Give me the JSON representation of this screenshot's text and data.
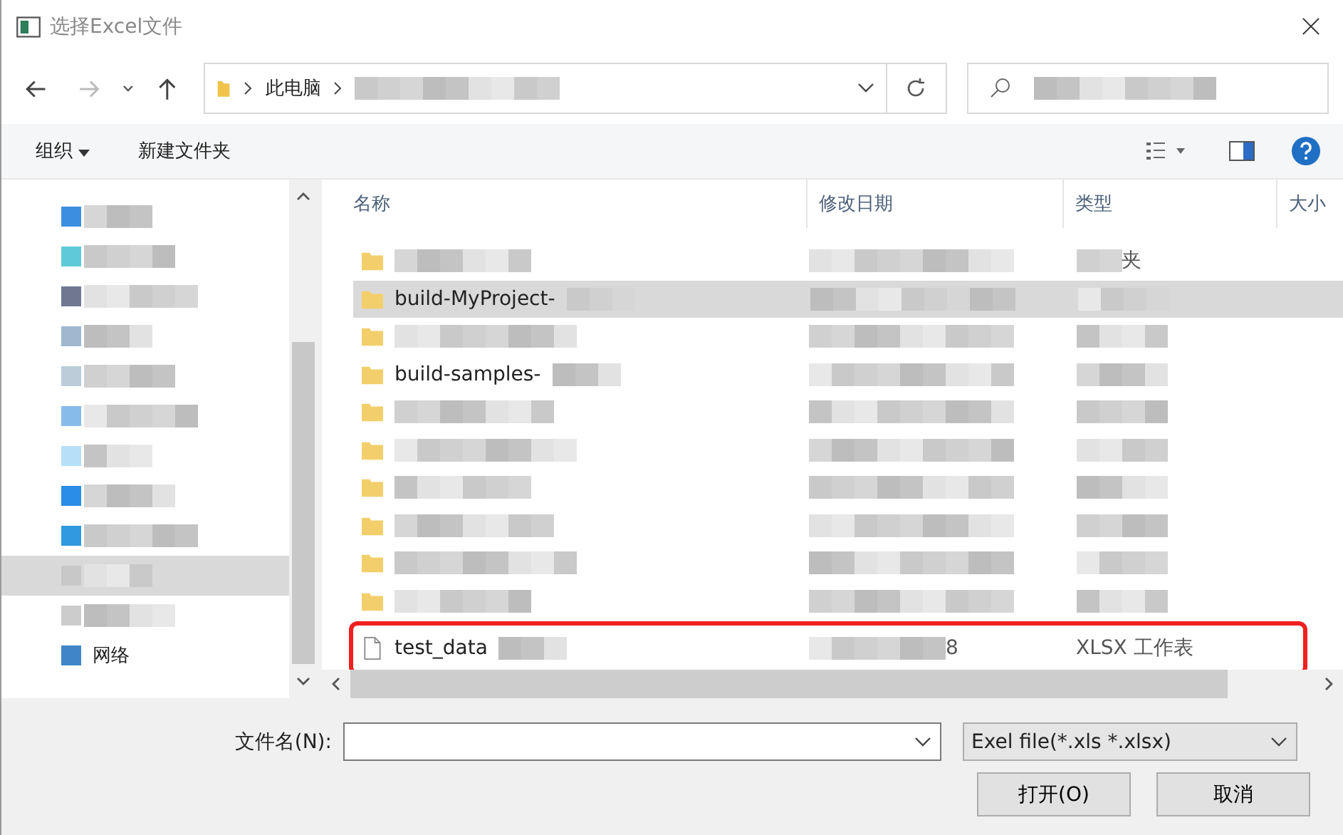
{
  "window": {
    "title": "选择Excel文件"
  },
  "address": {
    "segments": [
      "此电脑"
    ]
  },
  "toolbar": {
    "organize": "组织",
    "new_folder": "新建文件夹"
  },
  "sidebar": {
    "items": [
      {
        "color": "#3c8fe0",
        "selected": false
      },
      {
        "color": "#5fc9d9",
        "selected": false
      },
      {
        "color": "#6f7890",
        "selected": false
      },
      {
        "color": "#9fb8cf",
        "selected": false
      },
      {
        "color": "#bcccd8",
        "selected": false
      },
      {
        "color": "#86bbea",
        "selected": false
      },
      {
        "color": "#b5e0f8",
        "selected": false
      },
      {
        "color": "#2a8ee8",
        "selected": false
      },
      {
        "color": "#2f9ae0",
        "selected": false
      },
      {
        "color": "#c8c8c8",
        "selected": true
      },
      {
        "color": "#cccccc",
        "selected": false
      },
      {
        "color": "#3f86c8",
        "selected": false,
        "label": "网络"
      }
    ]
  },
  "table": {
    "columns": [
      "名称",
      "修改日期",
      "类型",
      "大小"
    ],
    "rows": [
      {
        "kind": "folder",
        "type": "夹",
        "selected": false
      },
      {
        "kind": "folder",
        "name": "build-MyProject-",
        "selected": true
      },
      {
        "kind": "folder",
        "selected": false
      },
      {
        "kind": "folder",
        "name": "build-samples-",
        "selected": false
      },
      {
        "kind": "folder",
        "selected": false
      },
      {
        "kind": "folder",
        "selected": false
      },
      {
        "kind": "folder",
        "selected": false
      },
      {
        "kind": "folder",
        "selected": false
      },
      {
        "kind": "folder",
        "selected": false
      },
      {
        "kind": "folder",
        "selected": false
      },
      {
        "kind": "file",
        "name": "test_data",
        "date": "8",
        "type": "XLSX 工作表",
        "selected": false,
        "annotated": true
      }
    ]
  },
  "filename": {
    "label": "文件名(N):"
  },
  "filter": {
    "value": "Exel file(*.xls *.xlsx)"
  },
  "buttons": [
    "打开(O)",
    "取消"
  ]
}
